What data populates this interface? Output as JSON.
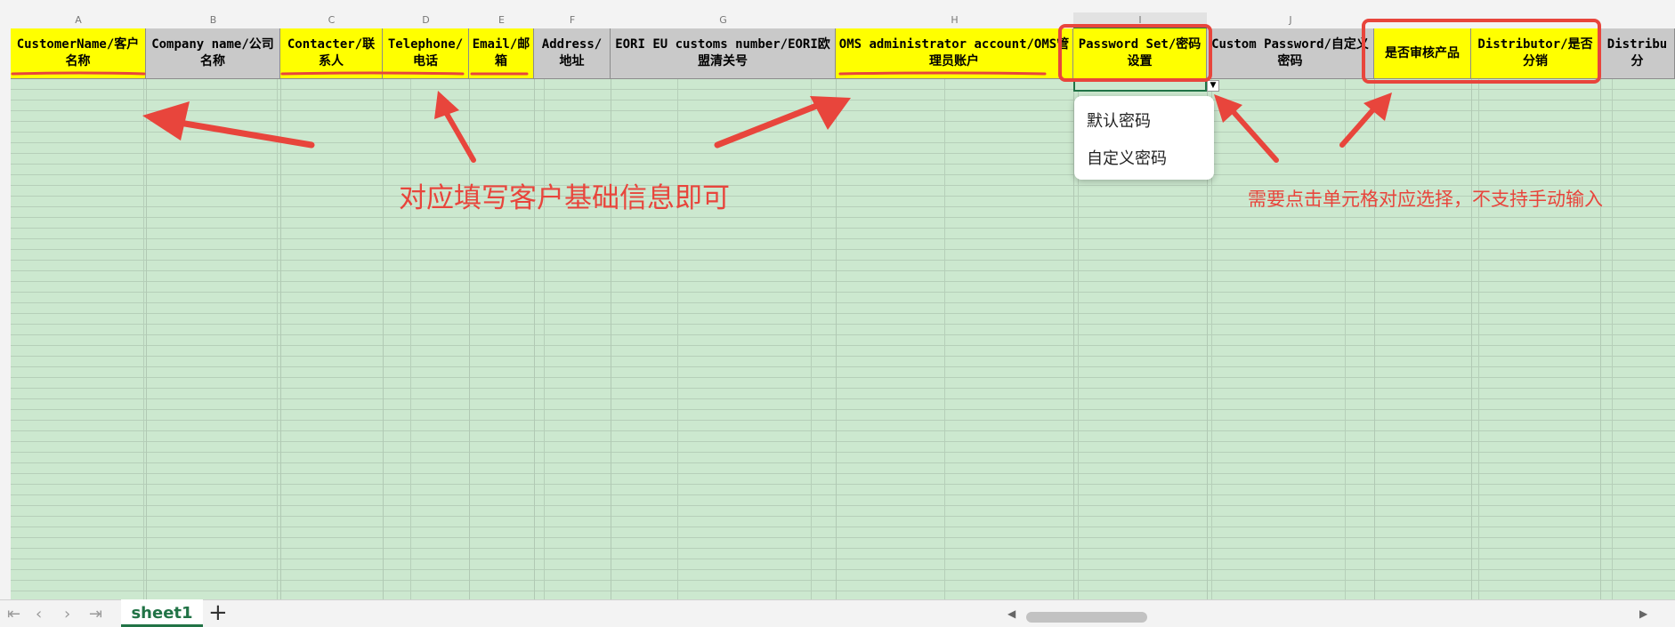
{
  "columns": [
    {
      "letter": "A",
      "header": "CustomerName/客户名称"
    },
    {
      "letter": "B",
      "header": "Company name/公司名称"
    },
    {
      "letter": "C",
      "header": "Contacter/联系人"
    },
    {
      "letter": "D",
      "header": "Telephone/电话"
    },
    {
      "letter": "E",
      "header": "Email/邮箱"
    },
    {
      "letter": "F",
      "header": "Address/地址"
    },
    {
      "letter": "G",
      "header": "EORI EU customs number/EORI欧盟清关号"
    },
    {
      "letter": "H",
      "header": "OMS administrator account/OMS管理员账户"
    },
    {
      "letter": "I",
      "header": "Password Set/密码设置"
    },
    {
      "letter": "J",
      "header": "Custom Password/自定义密码"
    },
    {
      "letter": "",
      "header": "是否审核产品"
    },
    {
      "letter": "",
      "header": "Distributor/是否分销"
    },
    {
      "letter": "",
      "header": "Distribu 分"
    }
  ],
  "dropdown": {
    "options": [
      "默认密码",
      "自定义密码"
    ]
  },
  "annotations": {
    "left": "对应填写客户基础信息即可",
    "right": "需要点击单元格对应选择，不支持手动输入"
  },
  "sheet": {
    "tab_label": "sheet1",
    "add_label": "+"
  },
  "colors": {
    "header_required": "#ffff00",
    "header_optional": "#c9c9c9",
    "grid_background": "#cce8cf",
    "annotation": "#e8453c",
    "accent": "#217346"
  }
}
